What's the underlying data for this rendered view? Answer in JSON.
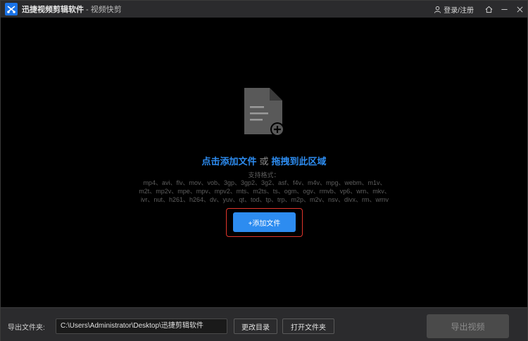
{
  "titlebar": {
    "app_name": "迅捷视频剪辑软件",
    "separator": " - ",
    "mode": "视频快剪",
    "login_label": "登录/注册",
    "icons": [
      "home-icon",
      "minimize-icon",
      "close-icon"
    ]
  },
  "dropzone": {
    "click_add_label": "点击添加文件",
    "or_label": "或",
    "drag_label": "拖拽到此区域",
    "formats_title": "支持格式：",
    "formats_lines": [
      "mp4、avi、flv、mov、vob、3gp、3gp2、3g2、asf、f4v、m4v、mpg、webm、m1v、",
      "m2t、mp2v、mpe、mpv、mpv2、mts、m2ts、ts、ogm、ogv、rmvb、vp6、wm、mkv、",
      "ivr、nut、h261、h264、dv、yuv、qt、tod、tp、trp、m2p、m2v、nsv、divx、rm、wmv"
    ],
    "add_button_label": "+添加文件"
  },
  "bottombar": {
    "export_folder_label": "导出文件夹:",
    "path_value": "C:\\Users\\Administrator\\Desktop\\迅捷剪辑软件",
    "change_dir_label": "更改目录",
    "open_folder_label": "打开文件夹",
    "export_button_label": "导出视频"
  },
  "colors": {
    "accent": "#2d8cf0",
    "highlight": "#e0352b",
    "titlebar_bg": "#2b2b2d",
    "canvas_bg": "#000000"
  }
}
